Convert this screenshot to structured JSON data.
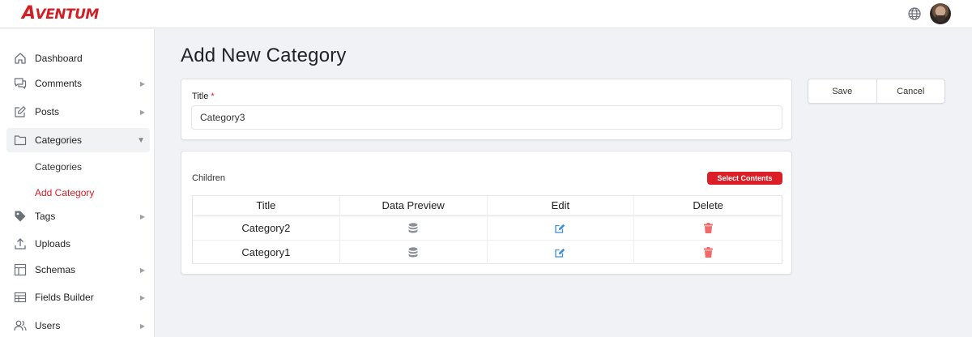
{
  "brand": {
    "logo_first": "A",
    "logo_rest": "VENTUM"
  },
  "header": {
    "globe_icon": "globe-icon",
    "avatar": "user-avatar"
  },
  "sidebar": {
    "items": [
      {
        "label": "Dashboard",
        "icon": "home-icon",
        "has_arrow": false
      },
      {
        "label": "Comments",
        "icon": "comments-icon",
        "has_arrow": true
      },
      {
        "label": "Posts",
        "icon": "edit-icon",
        "has_arrow": true
      },
      {
        "label": "Categories",
        "icon": "folder-icon",
        "has_arrow": true,
        "expanded": true
      },
      {
        "label": "Tags",
        "icon": "tag-icon",
        "has_arrow": true
      },
      {
        "label": "Uploads",
        "icon": "upload-icon",
        "has_arrow": false
      },
      {
        "label": "Schemas",
        "icon": "layout-icon",
        "has_arrow": true
      },
      {
        "label": "Fields Builder",
        "icon": "table-icon",
        "has_arrow": true
      },
      {
        "label": "Users",
        "icon": "users-icon",
        "has_arrow": true
      }
    ],
    "sub_items": [
      {
        "label": "Categories",
        "current": false
      },
      {
        "label": "Add Category",
        "current": true
      }
    ],
    "arrow_collapsed": "▶",
    "arrow_expanded": "▼"
  },
  "main": {
    "page_title": "Add New Category",
    "title_field": {
      "label": "Title",
      "required_mark": "*",
      "value": "Category3"
    },
    "actions": {
      "save_label": "Save",
      "cancel_label": "Cancel"
    },
    "children": {
      "label": "Children",
      "select_button": "Select Contents",
      "columns": [
        "Title",
        "Data Preview",
        "Edit",
        "Delete"
      ],
      "rows": [
        {
          "title": "Category2"
        },
        {
          "title": "Category1"
        }
      ]
    }
  },
  "colors": {
    "brand_red": "#d11f26",
    "edit_blue": "#3f8fd8",
    "delete_red": "#f06a6a",
    "db_gray": "#8a9099"
  }
}
